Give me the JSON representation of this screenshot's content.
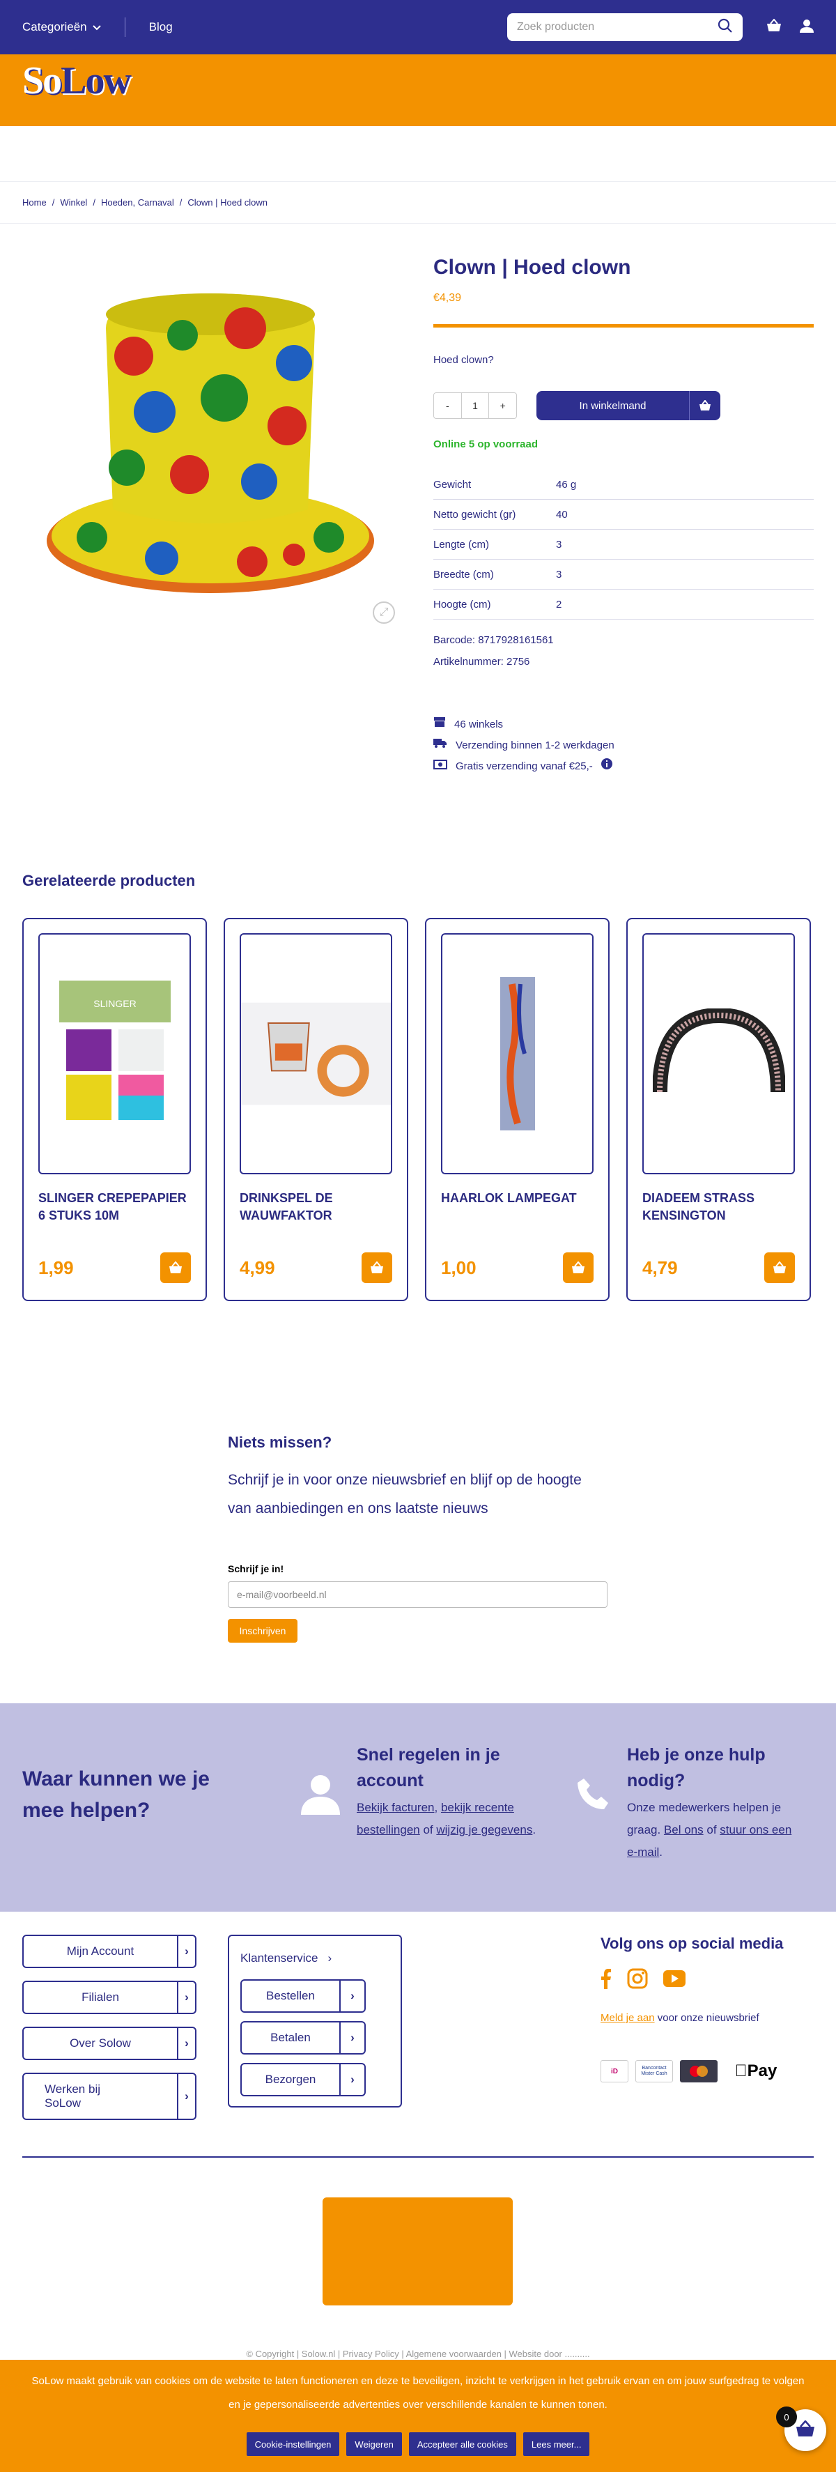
{
  "nav": {
    "categories": "Categorieën",
    "blog": "Blog",
    "search_placeholder": "Zoek producten"
  },
  "logo": {
    "part1": "So",
    "part2": "Low"
  },
  "breadcrumb": [
    "Home",
    "Winkel",
    "Hoeden, Carnaval",
    "Clown | Hoed clown"
  ],
  "product": {
    "title": "Clown | Hoed clown",
    "price": "€4,39",
    "short_description": "Hoed clown?",
    "qty_minus": "-",
    "qty": "1",
    "qty_plus": "+",
    "add_to_cart": "In winkelmand",
    "stock": "Online 5 op voorraad",
    "specs": [
      {
        "k": "Gewicht",
        "v": "46 g"
      },
      {
        "k": "Netto gewicht (gr)",
        "v": "40"
      },
      {
        "k": "Lengte (cm)",
        "v": "3"
      },
      {
        "k": "Breedte (cm)",
        "v": "3"
      },
      {
        "k": "Hoogte (cm)",
        "v": "2"
      }
    ],
    "barcode": "Barcode: 8717928161561",
    "article": "Artikelnummer: 2756",
    "features": [
      "46 winkels",
      "Verzending binnen 1-2 werkdagen",
      "Gratis verzending vanaf €25,-"
    ]
  },
  "related": {
    "title": "Gerelateerde producten",
    "items": [
      {
        "name": "SLINGER CREPEPAPIER 6 STUKS 10M",
        "price": "1,99"
      },
      {
        "name": "DRINKSPEL DE WAUWFAKTOR",
        "price": "4,99"
      },
      {
        "name": "HAARLOK LAMPEGAT",
        "price": "1,00"
      },
      {
        "name": "DIADEEM STRASS KENSINGTON",
        "price": "4,79"
      }
    ]
  },
  "newsletter": {
    "title": "Niets missen?",
    "text": "Schrijf je in voor onze nieuwsbrief en blijf op de hoogte van aanbiedingen en ons laatste nieuws",
    "label": "Schrijf je in!",
    "placeholder": "e-mail@voorbeeld.nl",
    "button": "Inschrijven"
  },
  "help": {
    "title": "Waar kunnen we je mee helpen?",
    "account_title": "Snel regelen in je account",
    "account_l1": "Bekijk facturen",
    "account_s1": ", ",
    "account_l2": "bekijk recente bestellingen",
    "account_s2": " of ",
    "account_l3": "wijzig je gegevens",
    "account_end": ".",
    "contact_title": "Heb je onze hulp nodig?",
    "contact_p1": "Onze medewerkers helpen je graag. ",
    "contact_l1": "Bel ons",
    "contact_s1": " of ",
    "contact_l2": "stuur ons een e-mail",
    "contact_end": "."
  },
  "footer": {
    "col1": [
      "Mijn Account",
      "Filialen",
      "Over Solow",
      "Werken bij SoLow"
    ],
    "service_title": "Klantenservice",
    "service_items": [
      "Bestellen",
      "Betalen",
      "Bezorgen"
    ],
    "social_title": "Volg ons op social media",
    "newsletter_link": "Meld je aan",
    "newsletter_text": " voor onze nieuwsbrief",
    "payments": [
      "iDEAL",
      "Bancontact Mister Cash",
      "Creditcard",
      "Apple Pay"
    ]
  },
  "copyright": "© Copyright   |   Solow.nl   |   Privacy Policy   |   Algemene voorwaarden   |   Website door ..........",
  "cookie": {
    "text": "SoLow maakt gebruik van cookies om de website te laten functioneren en deze te beveiligen, inzicht te verkrijgen in het gebruik ervan en om jouw surfgedrag te volgen en je gepersonaliseerde advertenties over verschillende kanalen te kunnen tonen.",
    "buttons": [
      "Cookie-instellingen",
      "Weigeren",
      "Accepteer alle cookies",
      "Lees meer..."
    ]
  },
  "cart_count": "0",
  "colors": {
    "brand_blue": "#2e2f8f",
    "brand_orange": "#f39200",
    "stock_green": "#2db52d"
  }
}
